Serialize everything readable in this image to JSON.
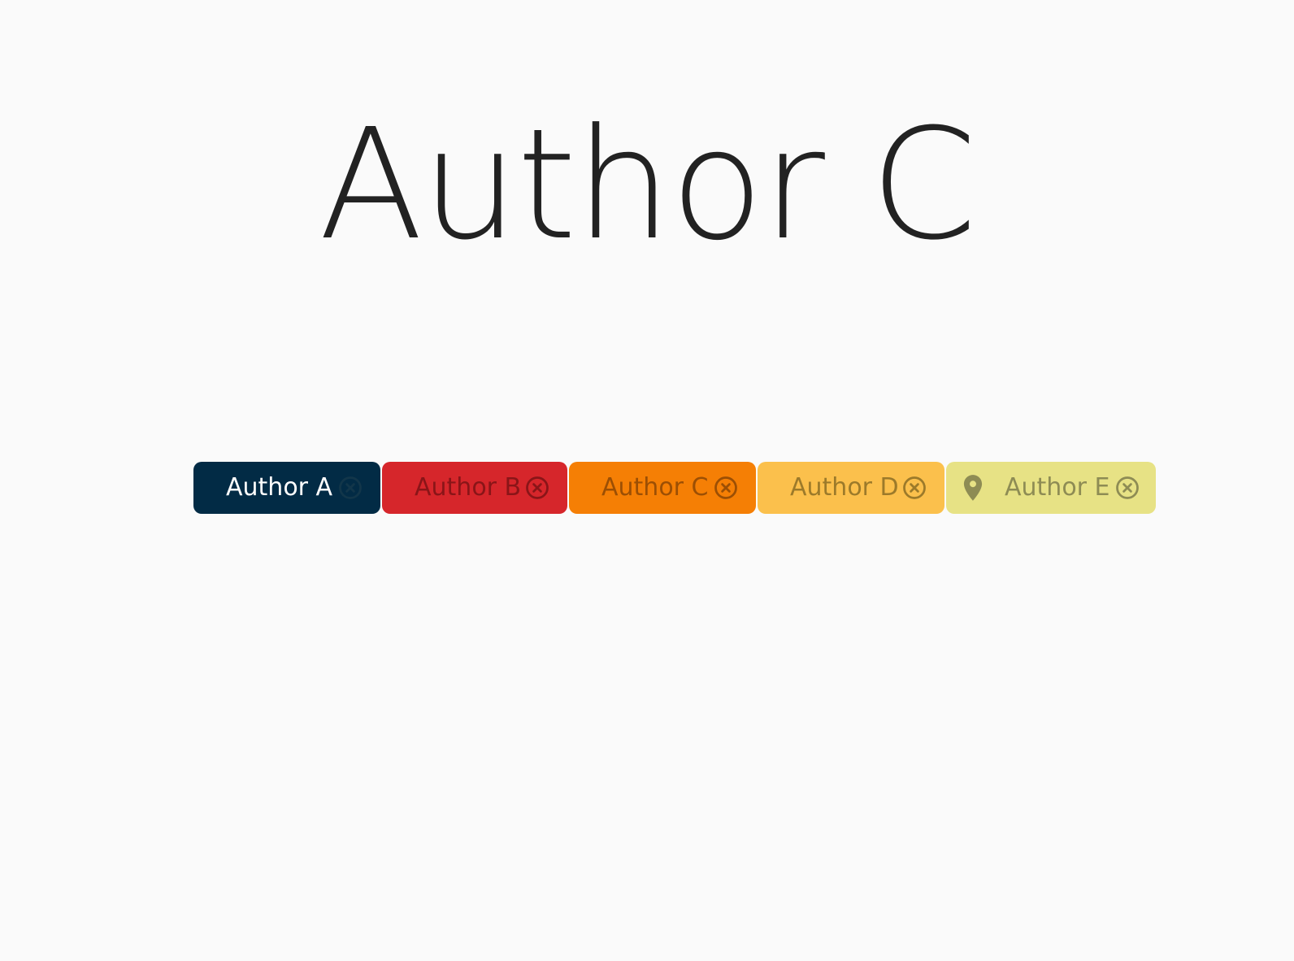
{
  "heading": "Author C",
  "chips": [
    {
      "label": "Author A",
      "bg": "#022b45",
      "fg": "#ffffff",
      "icon": "close-circle-icon",
      "iconColor": "#12364a"
    },
    {
      "label": "Author B",
      "bg": "#d6262b",
      "fg": "#8a1518",
      "icon": "close-circle-icon",
      "iconColor": "#8a1518"
    },
    {
      "label": "Author C",
      "bg": "#f57f05",
      "fg": "#9c4f04",
      "icon": "close-circle-icon",
      "iconColor": "#9c4f04"
    },
    {
      "label": "Author D",
      "bg": "#fbc04c",
      "fg": "#9c7a2a",
      "icon": "close-circle-icon",
      "iconColor": "#9c7a2a"
    },
    {
      "label": "Author E",
      "bg": "#e7e285",
      "fg": "#8e8c54",
      "icon": "close-circle-icon",
      "iconColor": "#8e8c54",
      "leadingIcon": "location-pin-icon"
    }
  ]
}
